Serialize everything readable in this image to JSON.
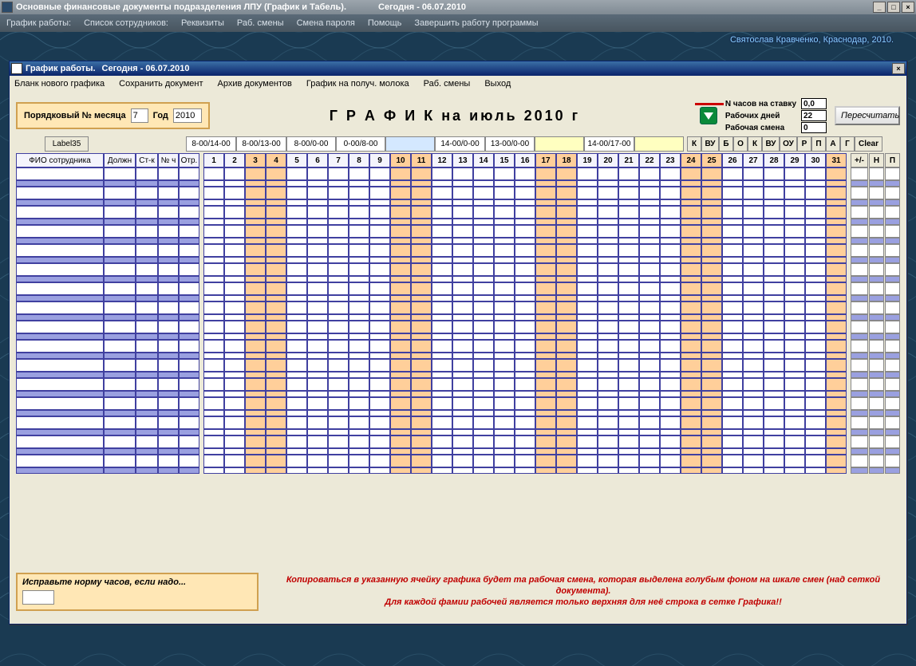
{
  "outer": {
    "title": "Основные финансовые документы подразделения  ЛПУ  (График и Табель).",
    "date": "Сегодня - 06.07.2010",
    "menu": [
      "График  работы:",
      "Список сотрудников:",
      "Реквизиты",
      "Раб. смены",
      "Смена пароля",
      "Помощь",
      "Завершить работу программы"
    ],
    "credit": "Святослав Кравченко, Краснодар, 2010."
  },
  "inner": {
    "title": "График работы.",
    "date": "Сегодня - 06.07.2010",
    "menu": [
      "Бланк нового графика",
      "Сохранить документ",
      "Архив документов",
      "График на получ. молока",
      "Раб. смены",
      "Выход"
    ]
  },
  "params": {
    "month_label": "Порядковый № месяца",
    "month": "7",
    "year_label": "Год",
    "year": "2010",
    "heading": "Г Р А Ф И К  на      июль    2010 г",
    "stats": {
      "hours_label": "N часов на ставку",
      "hours": "0,0",
      "days_label": "Рабочих дней",
      "days": "22",
      "shift_label": "Рабочая смена",
      "shift": "0"
    },
    "recalc": "Пересчитать"
  },
  "label35": "Label35",
  "shifts": [
    "8-00/14-00",
    "8-00/13-00",
    "8-00/0-00",
    "0-00/8-00",
    "",
    "14-00/0-00",
    "13-00/0-00",
    "",
    "14-00/17-00",
    ""
  ],
  "shift_widths": [
    63,
    63,
    62,
    62,
    62,
    63,
    62,
    62,
    63,
    62
  ],
  "shift_selected_index": 4,
  "codes": [
    "К",
    "ВУ",
    "Б",
    "О",
    "К",
    "ВУ",
    "ОУ",
    "Р",
    "П",
    "А",
    "Г",
    "Clear"
  ],
  "code_widths": [
    18,
    22,
    18,
    18,
    18,
    22,
    22,
    18,
    18,
    18,
    18,
    35
  ],
  "left_headers": [
    {
      "label": "ФИО сотрудника",
      "w": 110
    },
    {
      "label": "Должн",
      "w": 40
    },
    {
      "label": "Ст-к",
      "w": 28
    },
    {
      "label": "№ ч",
      "w": 26
    },
    {
      "label": "Отр.",
      "w": 26
    }
  ],
  "days": [
    {
      "n": 1,
      "we": false
    },
    {
      "n": 2,
      "we": false
    },
    {
      "n": 3,
      "we": true
    },
    {
      "n": 4,
      "we": true
    },
    {
      "n": 5,
      "we": false
    },
    {
      "n": 6,
      "we": false
    },
    {
      "n": 7,
      "we": false
    },
    {
      "n": 8,
      "we": false
    },
    {
      "n": 9,
      "we": false
    },
    {
      "n": 10,
      "we": true
    },
    {
      "n": 11,
      "we": true
    },
    {
      "n": 12,
      "we": false
    },
    {
      "n": 13,
      "we": false
    },
    {
      "n": 14,
      "we": false
    },
    {
      "n": 15,
      "we": false
    },
    {
      "n": 16,
      "we": false
    },
    {
      "n": 17,
      "we": true
    },
    {
      "n": 18,
      "we": true
    },
    {
      "n": 19,
      "we": false
    },
    {
      "n": 20,
      "we": false
    },
    {
      "n": 21,
      "we": false
    },
    {
      "n": 22,
      "we": false
    },
    {
      "n": 23,
      "we": false
    },
    {
      "n": 24,
      "we": true
    },
    {
      "n": 25,
      "we": true
    },
    {
      "n": 26,
      "we": false
    },
    {
      "n": 27,
      "we": false
    },
    {
      "n": 28,
      "we": false
    },
    {
      "n": 29,
      "we": false
    },
    {
      "n": 30,
      "we": false
    },
    {
      "n": 31,
      "we": true
    }
  ],
  "right_headers": [
    "+/-",
    "Н",
    "П"
  ],
  "right_header_widths": [
    22,
    19,
    19
  ],
  "row_count": 32,
  "footer": {
    "fix_label": "Исправьте норму часов, если надо...",
    "hint1": "Копироваться в указанную ячейку графика будет та рабочая смена, которая выделена  голубым фоном на шкале смен (над сеткой документа).",
    "hint2": "Для каждой фамии рабочей является только верхняя для неё строка в сетке Графика!!"
  }
}
